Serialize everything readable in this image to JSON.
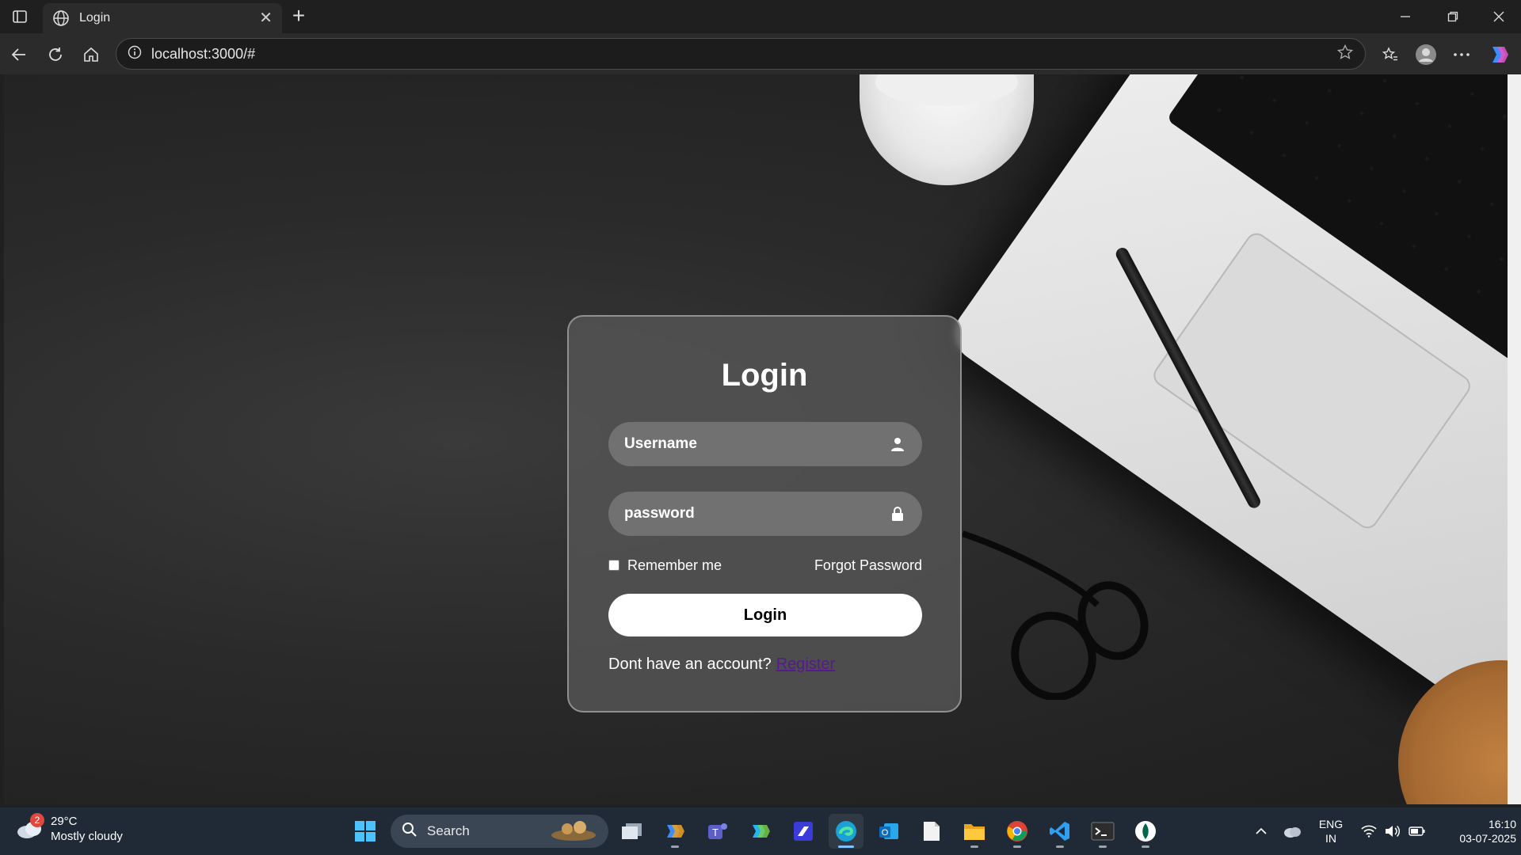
{
  "browser": {
    "tab_title": "Login",
    "url": "localhost:3000/#",
    "new_tab_symbol": "+",
    "tab_close_symbol": "✕"
  },
  "login_form": {
    "heading": "Login",
    "username_placeholder": "Username",
    "password_placeholder": "password",
    "remember_label": "Remember me",
    "remember_checked": false,
    "forgot_label": "Forgot Password",
    "submit_label": "Login",
    "signup_prompt": "Dont have an account?",
    "register_link": "Register"
  },
  "taskbar": {
    "weather_badge": "2",
    "temperature": "29°C",
    "condition": "Mostly cloudy",
    "search_label": "Search",
    "language_line1": "ENG",
    "language_line2": "IN",
    "time": "16:10",
    "date": "03-07-2025",
    "apps": [
      "task-view",
      "copilot",
      "teams",
      "m365",
      "visual-studio",
      "edge",
      "outlook",
      "notepad",
      "file-explorer",
      "chrome",
      "vscode",
      "terminal",
      "mongodb-compass"
    ]
  },
  "colors": {
    "card_bg": "#555555",
    "button_bg": "#ffffff",
    "register_link": "#551a8b",
    "taskbar_bg": "#1f2a36"
  }
}
